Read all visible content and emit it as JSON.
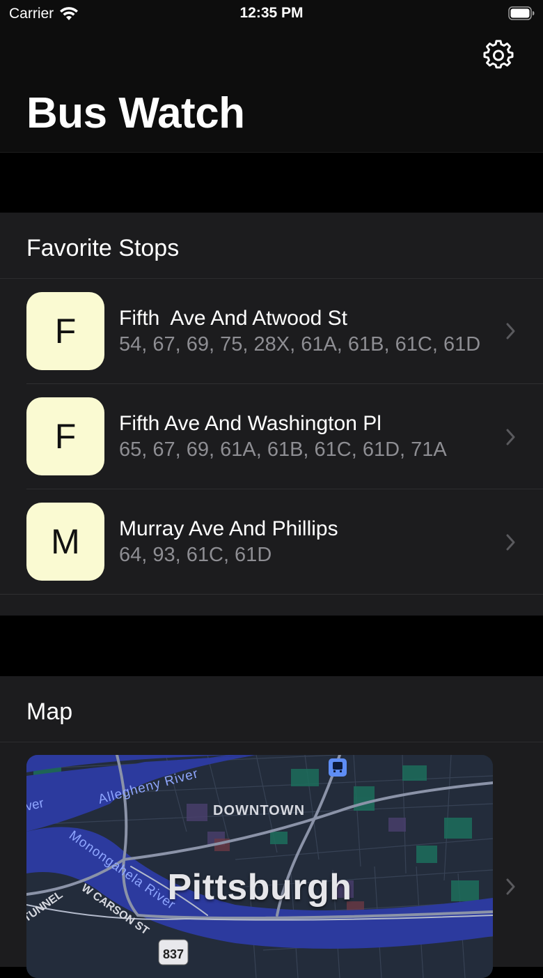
{
  "status_bar": {
    "carrier": "Carrier",
    "time": "12:35 PM"
  },
  "header": {
    "title": "Bus Watch",
    "settings_icon": "gear-icon"
  },
  "favorites": {
    "title": "Favorite Stops",
    "stops": [
      {
        "badge": "F",
        "name": "Fifth  Ave And Atwood St",
        "routes": "54, 67, 69, 75, 28X, 61A, 61B, 61C, 61D"
      },
      {
        "badge": "F",
        "name": "Fifth Ave And Washington Pl",
        "routes": "65, 67, 69, 61A, 61B, 61C, 61D, 71A"
      },
      {
        "badge": "M",
        "name": "Murray Ave And Phillips",
        "routes": "64, 93, 61C, 61D"
      }
    ]
  },
  "map": {
    "title": "Map",
    "city": "Pittsburgh",
    "labels": {
      "downtown": "DOWNTOWN",
      "allegheny": "Allegheny River",
      "monongahela": "Monongahela River",
      "carson": "W CARSON ST",
      "tunnel": "TUNNEL",
      "river_fragment": "ver",
      "route_shield": "837"
    }
  },
  "colors": {
    "badge_bg": "#fafad2",
    "section_bg": "#1c1c1e",
    "secondary_text": "#8e8e93",
    "river": "#2c3a9e",
    "park": "#1d6e5c"
  }
}
